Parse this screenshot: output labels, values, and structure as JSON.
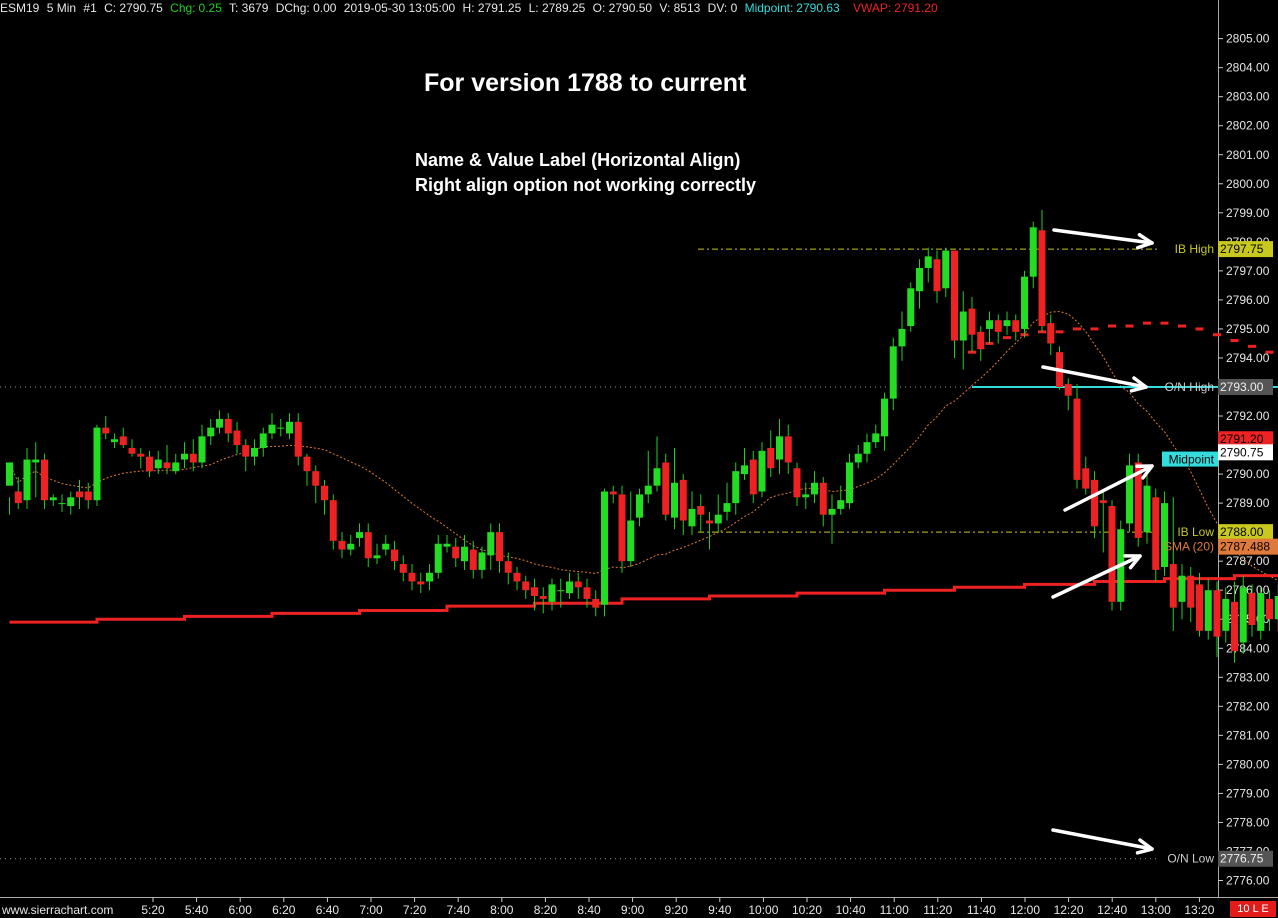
{
  "header": {
    "symbol": "ESM19",
    "timeframe": "5 Min",
    "chart_no": "#1",
    "close": "C: 2790.75",
    "chg_label": "Chg:",
    "chg_value": "0.25",
    "t": "T: 3679",
    "dchg": "DChg: 0.00",
    "datetime": "2019-05-30  13:05:00",
    "high": "H: 2791.25",
    "low": "L: 2789.25",
    "open": "O: 2790.50",
    "volume": "V: 8513",
    "dv": "DV: 0",
    "midpoint_label": "Midpoint:",
    "midpoint_value": "2790.63",
    "vwap_label": "VWAP:",
    "vwap_value": "2791.20"
  },
  "annotations": {
    "title": "For version 1788 to current",
    "line1": "Name & Value Label (Horizontal Align)",
    "line2": "Right align option not working correctly"
  },
  "footer": {
    "brand": "www.sierrachart.com",
    "scale_button": "10 L E"
  },
  "colors": {
    "background": "#000000",
    "up_candle": "#22dd22",
    "down_candle": "#ee2222",
    "wick": "#22cc22",
    "vwap": "#ee2222",
    "midpoint": "#33dddd",
    "sma": "#e07a3a",
    "ib_line": "#c8c81e",
    "on_line": "#9a9a9a",
    "arrow": "#ffffff"
  },
  "chart_data": {
    "type": "candlestick",
    "y_range": [
      2775.6,
      2805.8
    ],
    "y_ticks": [
      "2776.00",
      "2777.00",
      "2778.00",
      "2779.00",
      "2780.00",
      "2781.00",
      "2782.00",
      "2783.00",
      "2784.00",
      "2785.00",
      "2786.00",
      "2787.00",
      "2788.00",
      "2789.00",
      "2790.00",
      "2791.00",
      "2792.00",
      "2793.00",
      "2794.00",
      "2795.00",
      "2796.00",
      "2797.00",
      "2798.00",
      "2799.00",
      "2800.00",
      "2801.00",
      "2802.00",
      "2803.00",
      "2804.00",
      "2805.00"
    ],
    "x_labels": [
      "5:20",
      "5:40",
      "6:00",
      "6:20",
      "6:40",
      "7:00",
      "7:20",
      "7:40",
      "8:00",
      "8:20",
      "8:40",
      "9:00",
      "9:20",
      "9:40",
      "10:00",
      "10:20",
      "10:40",
      "11:00",
      "11:20",
      "11:40",
      "12:00",
      "12:20",
      "12:40",
      "13:00",
      "13:20"
    ],
    "candles": [
      [
        2789.6,
        2790.4,
        2789.2,
        2788.6
      ],
      [
        2789.4,
        2789.0,
        2789.9,
        2788.8
      ],
      [
        2789.1,
        2790.5,
        2790.9,
        2788.8
      ],
      [
        2790.4,
        2790.5,
        2791.1,
        2789.2
      ],
      [
        2790.5,
        2789.1,
        2790.7,
        2788.8
      ],
      [
        2789.1,
        2789.2,
        2789.3,
        2788.9
      ],
      [
        2789.0,
        2789.0,
        2789.3,
        2788.7
      ],
      [
        2788.9,
        2789.2,
        2789.4,
        2788.6
      ],
      [
        2789.4,
        2789.2,
        2789.8,
        2788.8
      ],
      [
        2789.4,
        2789.1,
        2789.7,
        2788.8
      ],
      [
        2789.1,
        2791.6,
        2791.7,
        2788.9
      ],
      [
        2791.6,
        2791.4,
        2792.0,
        2791.2
      ],
      [
        2791.1,
        2791.2,
        2791.4,
        2790.9
      ],
      [
        2791.3,
        2791.0,
        2791.6,
        2790.9
      ],
      [
        2790.9,
        2790.7,
        2791.2,
        2790.6
      ],
      [
        2790.7,
        2790.6,
        2790.9,
        2790.2
      ],
      [
        2790.6,
        2790.1,
        2790.8,
        2789.9
      ],
      [
        2790.2,
        2790.5,
        2790.8,
        2790.0
      ],
      [
        2790.4,
        2790.2,
        2791.0,
        2790.0
      ],
      [
        2790.1,
        2790.4,
        2790.7,
        2790.0
      ],
      [
        2790.5,
        2790.7,
        2791.1,
        2790.2
      ],
      [
        2790.7,
        2790.4,
        2791.2,
        2790.1
      ],
      [
        2790.4,
        2791.3,
        2791.7,
        2790.2
      ],
      [
        2791.3,
        2791.6,
        2791.9,
        2791.0
      ],
      [
        2791.6,
        2791.9,
        2792.2,
        2791.4
      ],
      [
        2791.9,
        2791.4,
        2792.1,
        2791.1
      ],
      [
        2791.5,
        2791.0,
        2791.8,
        2790.7
      ],
      [
        2791.0,
        2790.6,
        2791.2,
        2790.1
      ],
      [
        2790.6,
        2790.9,
        2791.2,
        2790.3
      ],
      [
        2790.9,
        2791.4,
        2791.6,
        2790.6
      ],
      [
        2791.4,
        2791.7,
        2792.1,
        2791.2
      ],
      [
        2791.6,
        2791.6,
        2791.9,
        2791.3
      ],
      [
        2791.4,
        2791.8,
        2792.1,
        2791.2
      ],
      [
        2791.8,
        2790.6,
        2792.1,
        2790.3
      ],
      [
        2790.6,
        2790.1,
        2790.7,
        2789.6
      ],
      [
        2790.1,
        2789.6,
        2790.3,
        2789.0
      ],
      [
        2789.6,
        2789.1,
        2789.8,
        2788.6
      ],
      [
        2789.1,
        2787.7,
        2789.3,
        2787.4
      ],
      [
        2787.7,
        2787.4,
        2788.0,
        2787.1
      ],
      [
        2787.4,
        2787.6,
        2787.9,
        2787.2
      ],
      [
        2787.8,
        2788.0,
        2788.3,
        2787.5
      ],
      [
        2788.0,
        2787.1,
        2788.3,
        2786.8
      ],
      [
        2787.1,
        2787.2,
        2787.6,
        2786.9
      ],
      [
        2787.4,
        2787.6,
        2787.9,
        2787.2
      ],
      [
        2787.4,
        2787.0,
        2787.7,
        2786.7
      ],
      [
        2786.9,
        2786.6,
        2787.2,
        2786.3
      ],
      [
        2786.6,
        2786.3,
        2786.9,
        2786.0
      ],
      [
        2786.3,
        2786.2,
        2786.6,
        2785.9
      ],
      [
        2786.3,
        2786.6,
        2786.9,
        2786.0
      ],
      [
        2786.6,
        2787.6,
        2787.9,
        2786.4
      ],
      [
        2787.5,
        2787.6,
        2787.9,
        2787.3
      ],
      [
        2787.5,
        2787.1,
        2787.8,
        2786.8
      ],
      [
        2787.0,
        2787.5,
        2787.9,
        2786.7
      ],
      [
        2787.4,
        2786.7,
        2787.7,
        2786.4
      ],
      [
        2786.7,
        2787.3,
        2787.5,
        2786.4
      ],
      [
        2787.2,
        2788.0,
        2788.3,
        2786.7
      ],
      [
        2788.0,
        2787.0,
        2788.3,
        2786.6
      ],
      [
        2787.0,
        2786.6,
        2787.3,
        2786.2
      ],
      [
        2786.6,
        2786.3,
        2786.8,
        2786.0
      ],
      [
        2786.3,
        2786.0,
        2786.5,
        2785.7
      ],
      [
        2786.1,
        2785.8,
        2786.4,
        2785.3
      ],
      [
        2785.8,
        2785.7,
        2786.1,
        2785.2
      ],
      [
        2785.6,
        2786.2,
        2786.4,
        2785.3
      ],
      [
        2786.0,
        2786.0,
        2786.4,
        2785.4
      ],
      [
        2785.9,
        2786.3,
        2786.6,
        2785.7
      ],
      [
        2786.3,
        2786.1,
        2786.6,
        2785.7
      ],
      [
        2786.1,
        2785.7,
        2786.4,
        2785.4
      ],
      [
        2785.7,
        2785.4,
        2786.0,
        2785.1
      ],
      [
        2785.5,
        2789.4,
        2789.5,
        2785.1
      ],
      [
        2789.4,
        2789.3,
        2789.6,
        2789.0
      ],
      [
        2789.3,
        2787.0,
        2789.6,
        2786.6
      ],
      [
        2787.0,
        2788.4,
        2789.4,
        2786.8
      ],
      [
        2788.5,
        2789.3,
        2789.5,
        2788.2
      ],
      [
        2789.3,
        2789.6,
        2790.8,
        2789.0
      ],
      [
        2789.6,
        2790.2,
        2791.3,
        2789.4
      ],
      [
        2790.4,
        2788.6,
        2790.7,
        2788.4
      ],
      [
        2788.5,
        2789.7,
        2790.9,
        2788.1
      ],
      [
        2789.8,
        2788.4,
        2790.0,
        2787.9
      ],
      [
        2788.2,
        2788.8,
        2789.4,
        2787.9
      ],
      [
        2788.9,
        2788.6,
        2789.3,
        2788.0
      ],
      [
        2788.4,
        2788.3,
        2788.7,
        2787.4
      ],
      [
        2788.3,
        2788.6,
        2789.3,
        2788.0
      ],
      [
        2788.7,
        2789.0,
        2789.7,
        2788.4
      ],
      [
        2789.0,
        2790.1,
        2790.4,
        2788.6
      ],
      [
        2790.0,
        2790.3,
        2790.9,
        2789.8
      ],
      [
        2790.5,
        2789.3,
        2790.8,
        2789.0
      ],
      [
        2789.4,
        2790.8,
        2791.1,
        2789.2
      ],
      [
        2790.9,
        2790.2,
        2791.5,
        2789.9
      ],
      [
        2790.5,
        2791.3,
        2791.9,
        2790.0
      ],
      [
        2791.3,
        2790.4,
        2791.7,
        2790.0
      ],
      [
        2790.2,
        2789.2,
        2790.4,
        2788.9
      ],
      [
        2789.2,
        2789.3,
        2789.7,
        2788.8
      ],
      [
        2789.3,
        2789.7,
        2790.1,
        2789.0
      ],
      [
        2789.7,
        2788.6,
        2789.9,
        2788.2
      ],
      [
        2788.6,
        2788.8,
        2789.3,
        2787.6
      ],
      [
        2788.8,
        2789.1,
        2789.6,
        2788.6
      ],
      [
        2789.0,
        2790.4,
        2790.7,
        2788.8
      ],
      [
        2790.4,
        2790.7,
        2791.0,
        2790.2
      ],
      [
        2790.7,
        2791.1,
        2791.4,
        2790.4
      ],
      [
        2791.1,
        2791.4,
        2791.7,
        2790.9
      ],
      [
        2791.3,
        2792.6,
        2792.8,
        2790.8
      ],
      [
        2792.6,
        2794.4,
        2794.7,
        2792.2
      ],
      [
        2794.4,
        2795.0,
        2795.6,
        2793.9
      ],
      [
        2795.1,
        2796.4,
        2796.6,
        2794.9
      ],
      [
        2796.3,
        2797.1,
        2797.4,
        2795.7
      ],
      [
        2797.1,
        2797.5,
        2797.8,
        2796.6
      ],
      [
        2797.4,
        2796.3,
        2797.7,
        2795.9
      ],
      [
        2796.4,
        2797.7,
        2797.8,
        2796.1
      ],
      [
        2797.7,
        2794.6,
        2797.7,
        2794.0
      ],
      [
        2794.6,
        2795.6,
        2796.3,
        2793.6
      ],
      [
        2795.7,
        2794.8,
        2796.1,
        2794.2
      ],
      [
        2794.9,
        2794.3,
        2795.1,
        2793.9
      ],
      [
        2795.0,
        2795.3,
        2795.6,
        2794.5
      ],
      [
        2795.3,
        2794.9,
        2795.5,
        2794.5
      ],
      [
        2795.1,
        2795.3,
        2795.6,
        2794.8
      ],
      [
        2795.3,
        2794.9,
        2795.5,
        2794.6
      ],
      [
        2795.0,
        2796.8,
        2797.0,
        2794.7
      ],
      [
        2796.8,
        2798.5,
        2798.7,
        2796.4
      ],
      [
        2798.4,
        2795.1,
        2799.1,
        2794.9
      ],
      [
        2795.2,
        2794.5,
        2795.5,
        2794.1
      ],
      [
        2794.2,
        2793.0,
        2794.4,
        2792.9
      ],
      [
        2793.1,
        2792.7,
        2793.3,
        2792.2
      ],
      [
        2792.6,
        2789.8,
        2793.1,
        2789.5
      ],
      [
        2790.2,
        2789.5,
        2790.6,
        2789.3
      ],
      [
        2789.8,
        2788.2,
        2790.1,
        2787.8
      ],
      [
        2789.1,
        2789.0,
        2789.4,
        2787.3
      ],
      [
        2788.9,
        2785.6,
        2789.1,
        2785.3
      ],
      [
        2785.6,
        2788.1,
        2788.4,
        2785.3
      ],
      [
        2788.3,
        2790.3,
        2790.7,
        2788.0
      ],
      [
        2790.4,
        2787.8,
        2790.7,
        2787.5
      ],
      [
        2788.0,
        2789.6,
        2790.1,
        2787.6
      ],
      [
        2789.2,
        2786.7,
        2789.5,
        2786.3
      ],
      [
        2786.8,
        2789.0,
        2789.4,
        2786.5
      ],
      [
        2786.9,
        2785.4,
        2789.2,
        2784.6
      ],
      [
        2785.6,
        2786.5,
        2786.9,
        2785.0
      ],
      [
        2786.5,
        2785.4,
        2786.8,
        2784.9
      ],
      [
        2786.2,
        2784.6,
        2786.6,
        2784.4
      ],
      [
        2784.6,
        2786.0,
        2786.4,
        2784.3
      ],
      [
        2786.0,
        2784.4,
        2786.3,
        2783.7
      ],
      [
        2784.6,
        2785.7,
        2786.1,
        2784.2
      ],
      [
        2785.6,
        2783.9,
        2786.3,
        2783.5
      ],
      [
        2784.2,
        2786.1,
        2786.5,
        2783.8
      ],
      [
        2785.9,
        2784.8,
        2786.2,
        2784.4
      ],
      [
        2784.6,
        2785.9,
        2786.1,
        2784.3
      ],
      [
        2785.7,
        2785.0,
        2786.0,
        2784.6
      ],
      [
        2785.0,
        2785.8,
        2786.2,
        2784.6
      ],
      [
        2785.8,
        2786.4,
        2786.9,
        2785.5
      ],
      [
        2786.4,
        2787.5,
        2787.9,
        2786.1
      ],
      [
        2787.4,
        2786.3,
        2787.7,
        2786.0
      ],
      [
        2786.2,
        2787.2,
        2787.6,
        2785.9
      ],
      [
        2787.1,
        2786.0,
        2787.4,
        2785.7
      ],
      [
        2786.1,
        2787.0,
        2787.3,
        2785.8
      ],
      [
        2787.0,
        2786.6,
        2787.3,
        2786.3
      ],
      [
        2786.6,
        2786.2,
        2786.9,
        2785.8
      ],
      [
        2786.1,
        2787.9,
        2788.3,
        2785.8
      ],
      [
        2787.9,
        2786.8,
        2788.2,
        2786.4
      ],
      [
        2786.8,
        2786.1,
        2787.1,
        2785.7
      ],
      [
        2786.2,
        2787.4,
        2787.8,
        2785.9
      ],
      [
        2787.3,
        2786.3,
        2787.6,
        2786.0
      ],
      [
        2786.4,
        2786.2,
        2786.7,
        2785.9
      ],
      [
        2786.1,
        2786.5,
        2786.8,
        2785.8
      ],
      [
        2786.5,
        2787.6,
        2788.0,
        2786.2
      ],
      [
        2787.6,
        2786.6,
        2787.9,
        2786.3
      ],
      [
        2786.6,
        2787.3,
        2787.7,
        2786.3
      ],
      [
        2787.3,
        2790.2,
        2790.5,
        2787.0
      ],
      [
        2790.2,
        2791.3,
        2791.6,
        2789.9
      ],
      [
        2791.3,
        2792.2,
        2792.6,
        2791.0
      ],
      [
        2792.1,
        2792.6,
        2793.0,
        2791.8
      ],
      [
        2792.6,
        2791.6,
        2793.2,
        2791.3
      ],
      [
        2791.6,
        2791.0,
        2792.0,
        2790.6
      ],
      [
        2791.0,
        2790.6,
        2791.3,
        2790.0
      ],
      [
        2790.5,
        2790.8,
        2791.3,
        2789.3
      ]
    ],
    "vwap": [
      [
        2784.9,
        0
      ],
      [
        2785.0,
        10
      ],
      [
        2785.1,
        20
      ],
      [
        2785.2,
        30
      ],
      [
        2785.3,
        40
      ],
      [
        2785.45,
        50
      ],
      [
        2785.55,
        60
      ],
      [
        2785.7,
        70
      ],
      [
        2785.8,
        80
      ],
      [
        2785.9,
        90
      ],
      [
        2786.0,
        100
      ],
      [
        2786.1,
        108
      ],
      [
        2786.2,
        116
      ],
      [
        2786.3,
        124
      ],
      [
        2786.4,
        132
      ],
      [
        2786.5,
        140
      ],
      [
        2786.55,
        148
      ],
      [
        2786.6,
        156
      ],
      [
        2786.6,
        164
      ],
      [
        2786.6,
        172
      ],
      [
        2786.6,
        180
      ],
      [
        2786.55,
        188
      ],
      [
        2786.55,
        196
      ],
      [
        2786.6,
        204
      ],
      [
        2786.65,
        212
      ],
      [
        2786.7,
        220
      ],
      [
        2786.8,
        228
      ],
      [
        2786.85,
        236
      ],
      [
        2786.95,
        244
      ],
      [
        2787.0,
        252
      ],
      [
        2787.05,
        260
      ],
      [
        2787.1,
        268
      ],
      [
        2787.2,
        280
      ]
    ],
    "midpoint_segments": [
      [
        2793.0,
        290,
        330
      ],
      [
        2793.3,
        330,
        410
      ],
      [
        2793.2,
        410,
        440
      ],
      [
        2793.1,
        440,
        460
      ],
      [
        2793.0,
        460,
        480
      ],
      [
        2791.1,
        480,
        545
      ],
      [
        2791.0,
        545,
        570
      ],
      [
        2790.6,
        570,
        580
      ],
      [
        2790.6,
        580,
        630
      ]
    ],
    "levels": {
      "ib_high": {
        "label": "IB High",
        "value": "2797.75",
        "y": 2797.75
      },
      "on_high": {
        "label": "O/N High",
        "value": "2793.00",
        "y": 2793.0
      },
      "ib_low": {
        "label": "IB Low",
        "value": "2788.00",
        "y": 2788.0
      },
      "on_low": {
        "label": "O/N Low",
        "value": "2776.75",
        "y": 2776.75
      },
      "sma": {
        "label": "SMA (20)",
        "value": "2787.488"
      },
      "vwap": {
        "value": "2791.20"
      },
      "price": {
        "value": "2790.75"
      },
      "midpoint": {
        "label": "Midpoint"
      }
    }
  }
}
